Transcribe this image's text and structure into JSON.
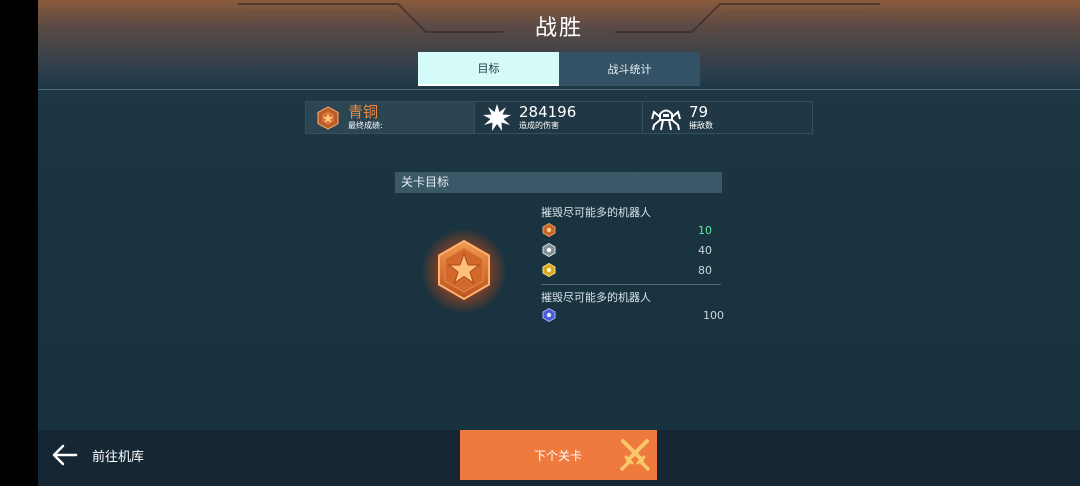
{
  "header": {
    "title": "战胜"
  },
  "tabs": [
    {
      "label": "目标",
      "active": true
    },
    {
      "label": "战斗统计",
      "active": false
    }
  ],
  "stats": {
    "rank_name": "青铜",
    "rank_label": "最终成绩:",
    "damage_value": "284196",
    "damage_label": "造成的伤害",
    "kills_value": "79",
    "kills_label": "摧敌数"
  },
  "objectives": {
    "header": "关卡目标",
    "groups": [
      {
        "title": "摧毁尽可能多的机器人",
        "rows": [
          {
            "tier_icon": "bronze-rank-icon",
            "value": "10",
            "achieved": true
          },
          {
            "tier_icon": "silver-rank-icon",
            "value": "40",
            "achieved": false
          },
          {
            "tier_icon": "gold-rank-icon",
            "value": "80",
            "achieved": false
          }
        ]
      },
      {
        "title": "摧毁尽可能多的机器人",
        "rows": [
          {
            "tier_icon": "platinum-rank-icon",
            "value": "100",
            "achieved": false
          }
        ]
      }
    ]
  },
  "footer": {
    "back_label": "前往机库",
    "next_label": "下个关卡"
  },
  "colors": {
    "accent_orange": "#ef7a3e",
    "tab_active": "#d4fbf7",
    "achieved_green": "#63e8a0",
    "bronze": "#ed8a45"
  }
}
